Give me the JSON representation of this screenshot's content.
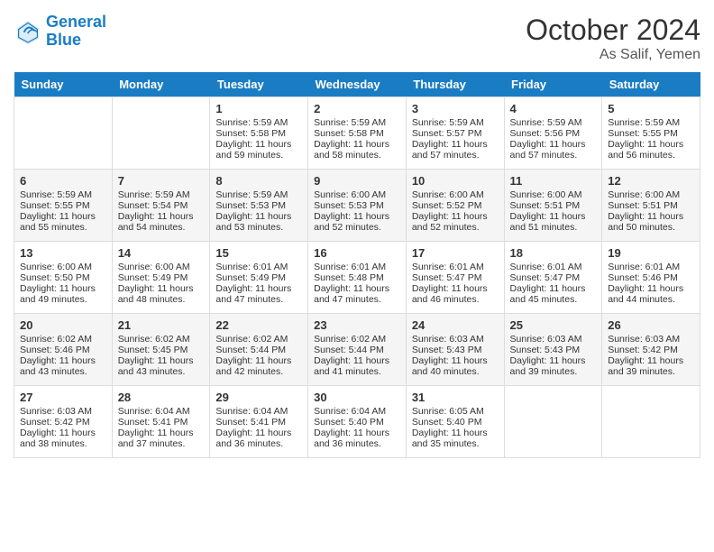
{
  "logo": {
    "line1": "General",
    "line2": "Blue"
  },
  "title": "October 2024",
  "subtitle": "As Salif, Yemen",
  "weekdays": [
    "Sunday",
    "Monday",
    "Tuesday",
    "Wednesday",
    "Thursday",
    "Friday",
    "Saturday"
  ],
  "weeks": [
    [
      {
        "day": "",
        "info": ""
      },
      {
        "day": "",
        "info": ""
      },
      {
        "day": "1",
        "sunrise": "Sunrise: 5:59 AM",
        "sunset": "Sunset: 5:58 PM",
        "daylight": "Daylight: 11 hours and 59 minutes."
      },
      {
        "day": "2",
        "sunrise": "Sunrise: 5:59 AM",
        "sunset": "Sunset: 5:58 PM",
        "daylight": "Daylight: 11 hours and 58 minutes."
      },
      {
        "day": "3",
        "sunrise": "Sunrise: 5:59 AM",
        "sunset": "Sunset: 5:57 PM",
        "daylight": "Daylight: 11 hours and 57 minutes."
      },
      {
        "day": "4",
        "sunrise": "Sunrise: 5:59 AM",
        "sunset": "Sunset: 5:56 PM",
        "daylight": "Daylight: 11 hours and 57 minutes."
      },
      {
        "day": "5",
        "sunrise": "Sunrise: 5:59 AM",
        "sunset": "Sunset: 5:55 PM",
        "daylight": "Daylight: 11 hours and 56 minutes."
      }
    ],
    [
      {
        "day": "6",
        "sunrise": "Sunrise: 5:59 AM",
        "sunset": "Sunset: 5:55 PM",
        "daylight": "Daylight: 11 hours and 55 minutes."
      },
      {
        "day": "7",
        "sunrise": "Sunrise: 5:59 AM",
        "sunset": "Sunset: 5:54 PM",
        "daylight": "Daylight: 11 hours and 54 minutes."
      },
      {
        "day": "8",
        "sunrise": "Sunrise: 5:59 AM",
        "sunset": "Sunset: 5:53 PM",
        "daylight": "Daylight: 11 hours and 53 minutes."
      },
      {
        "day": "9",
        "sunrise": "Sunrise: 6:00 AM",
        "sunset": "Sunset: 5:53 PM",
        "daylight": "Daylight: 11 hours and 52 minutes."
      },
      {
        "day": "10",
        "sunrise": "Sunrise: 6:00 AM",
        "sunset": "Sunset: 5:52 PM",
        "daylight": "Daylight: 11 hours and 52 minutes."
      },
      {
        "day": "11",
        "sunrise": "Sunrise: 6:00 AM",
        "sunset": "Sunset: 5:51 PM",
        "daylight": "Daylight: 11 hours and 51 minutes."
      },
      {
        "day": "12",
        "sunrise": "Sunrise: 6:00 AM",
        "sunset": "Sunset: 5:51 PM",
        "daylight": "Daylight: 11 hours and 50 minutes."
      }
    ],
    [
      {
        "day": "13",
        "sunrise": "Sunrise: 6:00 AM",
        "sunset": "Sunset: 5:50 PM",
        "daylight": "Daylight: 11 hours and 49 minutes."
      },
      {
        "day": "14",
        "sunrise": "Sunrise: 6:00 AM",
        "sunset": "Sunset: 5:49 PM",
        "daylight": "Daylight: 11 hours and 48 minutes."
      },
      {
        "day": "15",
        "sunrise": "Sunrise: 6:01 AM",
        "sunset": "Sunset: 5:49 PM",
        "daylight": "Daylight: 11 hours and 47 minutes."
      },
      {
        "day": "16",
        "sunrise": "Sunrise: 6:01 AM",
        "sunset": "Sunset: 5:48 PM",
        "daylight": "Daylight: 11 hours and 47 minutes."
      },
      {
        "day": "17",
        "sunrise": "Sunrise: 6:01 AM",
        "sunset": "Sunset: 5:47 PM",
        "daylight": "Daylight: 11 hours and 46 minutes."
      },
      {
        "day": "18",
        "sunrise": "Sunrise: 6:01 AM",
        "sunset": "Sunset: 5:47 PM",
        "daylight": "Daylight: 11 hours and 45 minutes."
      },
      {
        "day": "19",
        "sunrise": "Sunrise: 6:01 AM",
        "sunset": "Sunset: 5:46 PM",
        "daylight": "Daylight: 11 hours and 44 minutes."
      }
    ],
    [
      {
        "day": "20",
        "sunrise": "Sunrise: 6:02 AM",
        "sunset": "Sunset: 5:46 PM",
        "daylight": "Daylight: 11 hours and 43 minutes."
      },
      {
        "day": "21",
        "sunrise": "Sunrise: 6:02 AM",
        "sunset": "Sunset: 5:45 PM",
        "daylight": "Daylight: 11 hours and 43 minutes."
      },
      {
        "day": "22",
        "sunrise": "Sunrise: 6:02 AM",
        "sunset": "Sunset: 5:44 PM",
        "daylight": "Daylight: 11 hours and 42 minutes."
      },
      {
        "day": "23",
        "sunrise": "Sunrise: 6:02 AM",
        "sunset": "Sunset: 5:44 PM",
        "daylight": "Daylight: 11 hours and 41 minutes."
      },
      {
        "day": "24",
        "sunrise": "Sunrise: 6:03 AM",
        "sunset": "Sunset: 5:43 PM",
        "daylight": "Daylight: 11 hours and 40 minutes."
      },
      {
        "day": "25",
        "sunrise": "Sunrise: 6:03 AM",
        "sunset": "Sunset: 5:43 PM",
        "daylight": "Daylight: 11 hours and 39 minutes."
      },
      {
        "day": "26",
        "sunrise": "Sunrise: 6:03 AM",
        "sunset": "Sunset: 5:42 PM",
        "daylight": "Daylight: 11 hours and 39 minutes."
      }
    ],
    [
      {
        "day": "27",
        "sunrise": "Sunrise: 6:03 AM",
        "sunset": "Sunset: 5:42 PM",
        "daylight": "Daylight: 11 hours and 38 minutes."
      },
      {
        "day": "28",
        "sunrise": "Sunrise: 6:04 AM",
        "sunset": "Sunset: 5:41 PM",
        "daylight": "Daylight: 11 hours and 37 minutes."
      },
      {
        "day": "29",
        "sunrise": "Sunrise: 6:04 AM",
        "sunset": "Sunset: 5:41 PM",
        "daylight": "Daylight: 11 hours and 36 minutes."
      },
      {
        "day": "30",
        "sunrise": "Sunrise: 6:04 AM",
        "sunset": "Sunset: 5:40 PM",
        "daylight": "Daylight: 11 hours and 36 minutes."
      },
      {
        "day": "31",
        "sunrise": "Sunrise: 6:05 AM",
        "sunset": "Sunset: 5:40 PM",
        "daylight": "Daylight: 11 hours and 35 minutes."
      },
      {
        "day": "",
        "info": ""
      },
      {
        "day": "",
        "info": ""
      }
    ]
  ]
}
